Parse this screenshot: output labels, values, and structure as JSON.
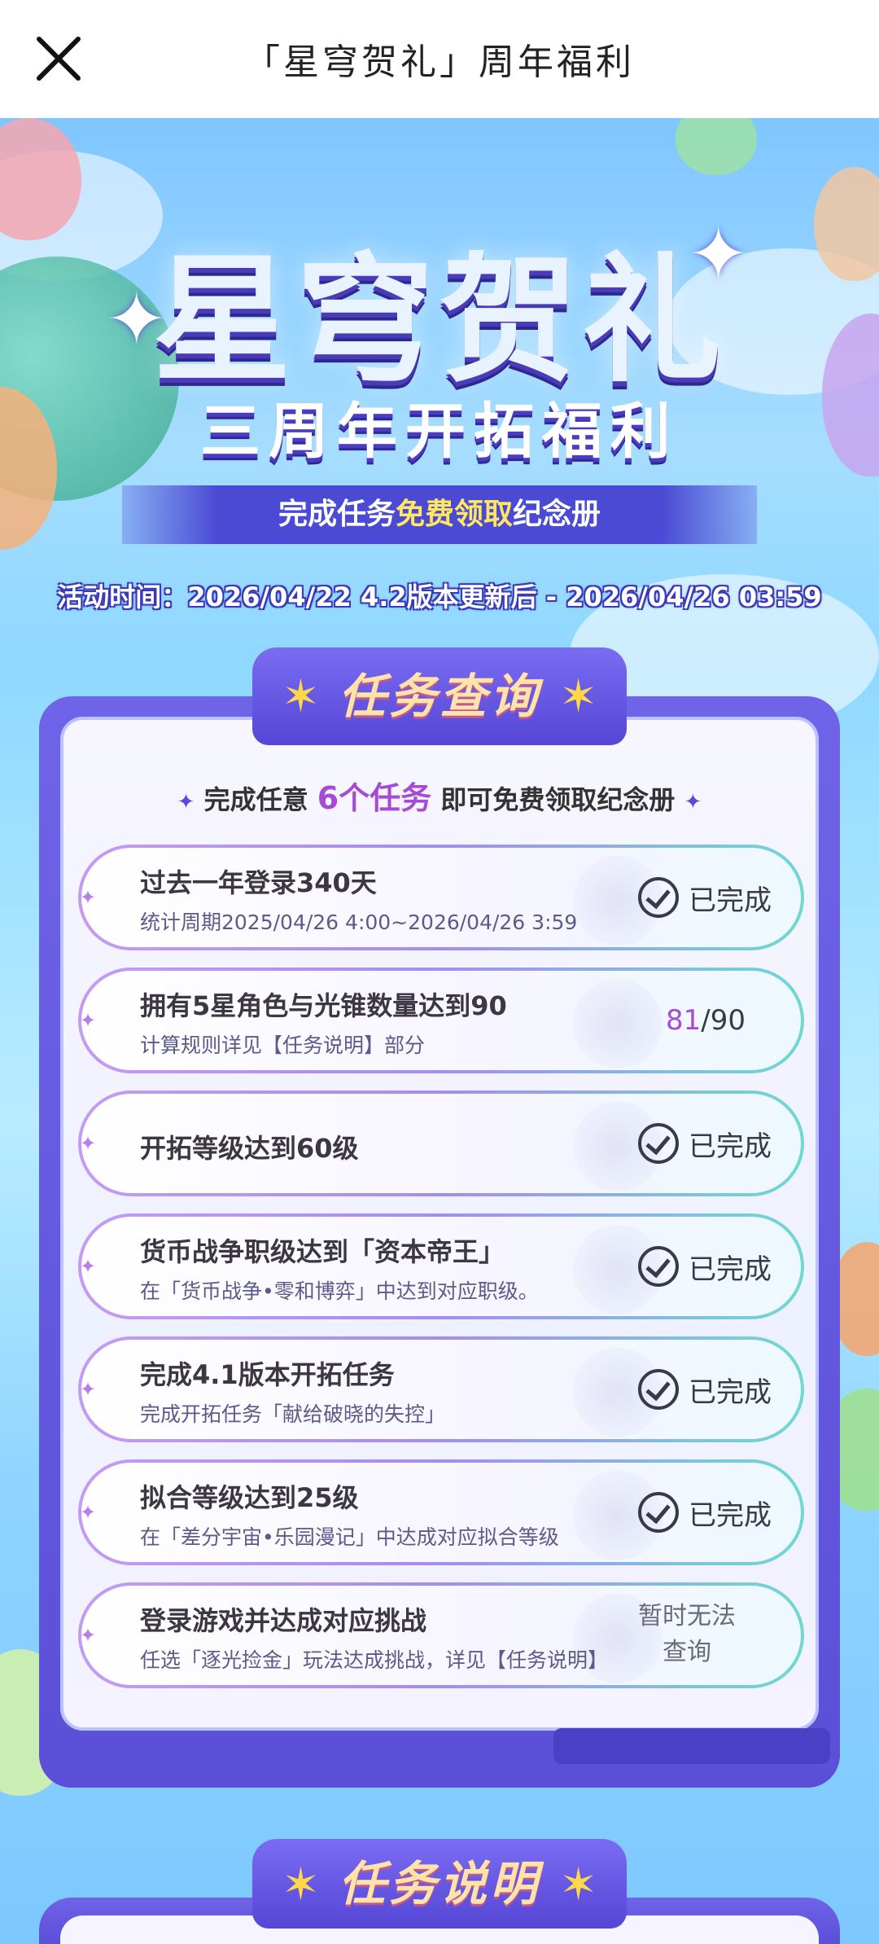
{
  "nav": {
    "title": "「星穹贺礼」周年福利",
    "close_icon": "close-icon"
  },
  "hero": {
    "logo_main": "星穹贺礼",
    "logo_sub": "三周年开拓福利",
    "tagline_pre": "完成任务",
    "tagline_highlight": "免费领取",
    "tagline_post": "纪念册",
    "period": "活动时间：2026/04/22 4.2版本更新后 - 2026/04/26 03:59"
  },
  "task_panel": {
    "header": "任务查询",
    "instruction_pre": "完成任意",
    "instruction_count": "6个任务",
    "instruction_post": "即可免费领取纪念册",
    "tasks": [
      {
        "title": "过去一年登录340天",
        "desc": "统计周期2025/04/26 4:00~2026/04/26 3:59",
        "status": "已完成"
      },
      {
        "title": "拥有5星角色与光锥数量达到90",
        "desc": "计算规则详见【任务说明】部分",
        "progress_current": "81",
        "progress_total": "/90"
      },
      {
        "title": "开拓等级达到60级",
        "desc": "",
        "status": "已完成"
      },
      {
        "title": "货币战争职级达到「资本帝王」",
        "desc": "在「货币战争•零和博弈」中达到对应职级。",
        "status": "已完成"
      },
      {
        "title": "完成4.1版本开拓任务",
        "desc": "完成开拓任务「献给破晓的失控」",
        "status": "已完成"
      },
      {
        "title": "拟合等级达到25级",
        "desc": "在「差分宇宙•乐园漫记」中达成对应拟合等级",
        "status": "已完成"
      },
      {
        "title": "登录游戏并达成对应挑战",
        "desc": "任选「逐光捡金」玩法达成挑战，详见【任务说明】",
        "status_line1": "暂时无法",
        "status_line2": "查询"
      }
    ]
  },
  "section2": {
    "header": "任务说明"
  },
  "colors": {
    "accent_purple": "#5b4fd8",
    "highlight_yellow": "#ffe760",
    "count_purple": "#a54bd6"
  }
}
